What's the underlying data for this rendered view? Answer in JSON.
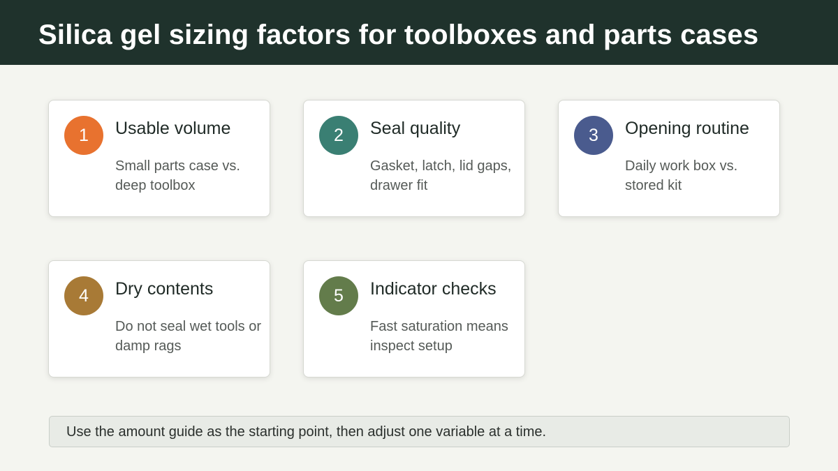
{
  "title": "Silica gel sizing factors for toolboxes and parts cases",
  "cards": [
    {
      "number": "1",
      "title": "Usable volume",
      "description": "Small parts case vs. deep toolbox",
      "color": "#e8722f"
    },
    {
      "number": "2",
      "title": "Seal quality",
      "description": "Gasket, latch, lid gaps, drawer fit",
      "color": "#3a7f73"
    },
    {
      "number": "3",
      "title": "Opening routine",
      "description": "Daily work box vs. stored kit",
      "color": "#4a5b8e"
    },
    {
      "number": "4",
      "title": "Dry contents",
      "description": "Do not seal wet tools or damp rags",
      "color": "#a87a36"
    },
    {
      "number": "5",
      "title": "Indicator checks",
      "description": "Fast saturation means inspect setup",
      "color": "#637c4b"
    }
  ],
  "footer_note": "Use the amount guide as the starting point, then adjust one variable at a time."
}
